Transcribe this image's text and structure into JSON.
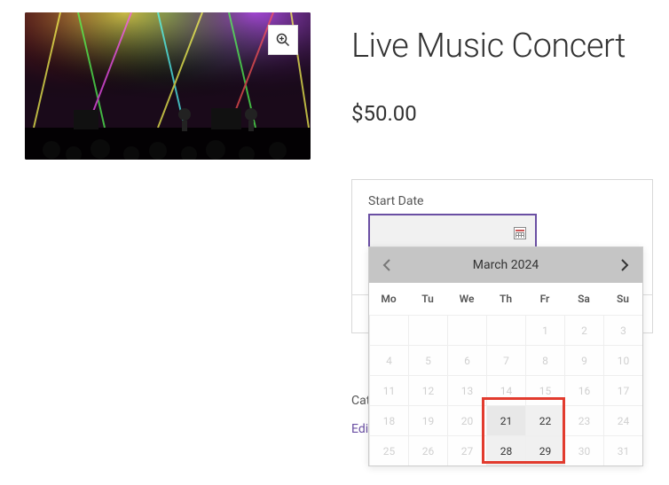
{
  "product": {
    "title": "Live Music Concert",
    "price": "$50.00"
  },
  "form": {
    "start_date_label": "Start Date"
  },
  "datepicker": {
    "month_year": "March 2024",
    "dow": [
      "Mo",
      "Tu",
      "We",
      "Th",
      "Fr",
      "Sa",
      "Su"
    ],
    "weeks": [
      [
        {
          "d": "",
          "s": "empty"
        },
        {
          "d": "",
          "s": "empty"
        },
        {
          "d": "",
          "s": "empty"
        },
        {
          "d": "",
          "s": "empty"
        },
        {
          "d": "1",
          "s": "disabled"
        },
        {
          "d": "2",
          "s": "disabled"
        },
        {
          "d": "3",
          "s": "disabled"
        }
      ],
      [
        {
          "d": "4",
          "s": "disabled"
        },
        {
          "d": "5",
          "s": "disabled"
        },
        {
          "d": "6",
          "s": "disabled"
        },
        {
          "d": "7",
          "s": "disabled"
        },
        {
          "d": "8",
          "s": "disabled"
        },
        {
          "d": "9",
          "s": "disabled"
        },
        {
          "d": "10",
          "s": "disabled"
        }
      ],
      [
        {
          "d": "11",
          "s": "disabled"
        },
        {
          "d": "12",
          "s": "disabled"
        },
        {
          "d": "13",
          "s": "disabled"
        },
        {
          "d": "14",
          "s": "disabled"
        },
        {
          "d": "15",
          "s": "disabled"
        },
        {
          "d": "16",
          "s": "disabled"
        },
        {
          "d": "17",
          "s": "disabled"
        }
      ],
      [
        {
          "d": "18",
          "s": "disabled"
        },
        {
          "d": "19",
          "s": "disabled"
        },
        {
          "d": "20",
          "s": "disabled"
        },
        {
          "d": "21",
          "s": "avail"
        },
        {
          "d": "22",
          "s": "avail light"
        },
        {
          "d": "23",
          "s": "disabled"
        },
        {
          "d": "24",
          "s": "disabled"
        }
      ],
      [
        {
          "d": "25",
          "s": "disabled"
        },
        {
          "d": "26",
          "s": "disabled"
        },
        {
          "d": "27",
          "s": "disabled"
        },
        {
          "d": "28",
          "s": "avail light"
        },
        {
          "d": "29",
          "s": "avail light"
        },
        {
          "d": "30",
          "s": "disabled"
        },
        {
          "d": "31",
          "s": "disabled"
        }
      ]
    ]
  },
  "meta": {
    "category_prefix": "Cat",
    "edit_prefix": "Edi"
  }
}
